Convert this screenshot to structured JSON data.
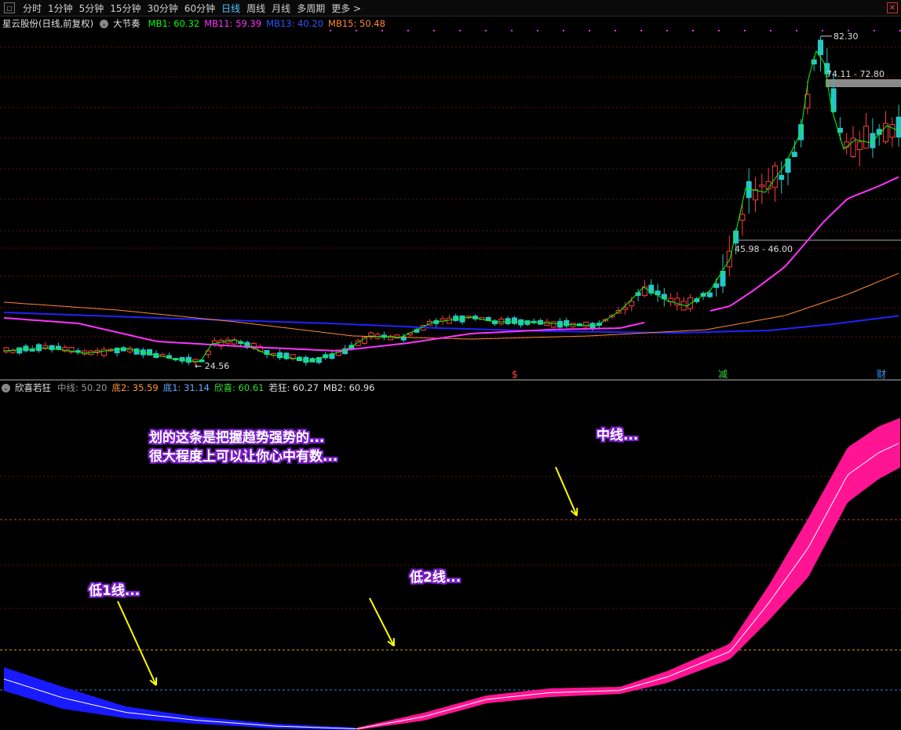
{
  "toolbar": {
    "items": [
      "分时",
      "1分钟",
      "5分钟",
      "15分钟",
      "30分钟",
      "60分钟",
      "日线",
      "周线",
      "月线",
      "多周期",
      "更多 >"
    ],
    "active_index": 6
  },
  "main_info": {
    "stock_name": "星云股份(日线,前复权)",
    "indicator_name": "大节奏",
    "mb1": "MB1: 60.32",
    "mb11": "MB11: 59.39",
    "mb13": "MB13: 40.20",
    "mb15": "MB15: 50.48"
  },
  "price_labels": {
    "high": "82.30",
    "low": "24.56",
    "zone_high": "74.11 - 72.80",
    "zone_low": "45.98 - 46.00"
  },
  "event_markers": [
    "$",
    "减",
    "财"
  ],
  "sub_info": {
    "indicator_name": "欣喜若狂",
    "zhongxian": "中线: 50.20",
    "di2": "底2: 35.59",
    "di1": "底1: 31.14",
    "xinxi": "欣喜: 60.61",
    "ruokuang": "若狂: 60.27",
    "mb2": "MB2: 60.96"
  },
  "annotations": {
    "line1": "划的这条是把握趋势强势的...",
    "line2": "很大程度上可以让你心中有数...",
    "mid": "中线...",
    "low1": "低1线...",
    "low2": "低2线..."
  },
  "colors": {
    "up": "#ff3b3b",
    "down": "#26c6c6",
    "mb1": "#00ff00",
    "mb11": "#ff33ff",
    "mb13": "#2222ff",
    "mb15": "#ff8833",
    "band_pink": "#ff1493",
    "band_blue": "#1a1aff"
  }
}
